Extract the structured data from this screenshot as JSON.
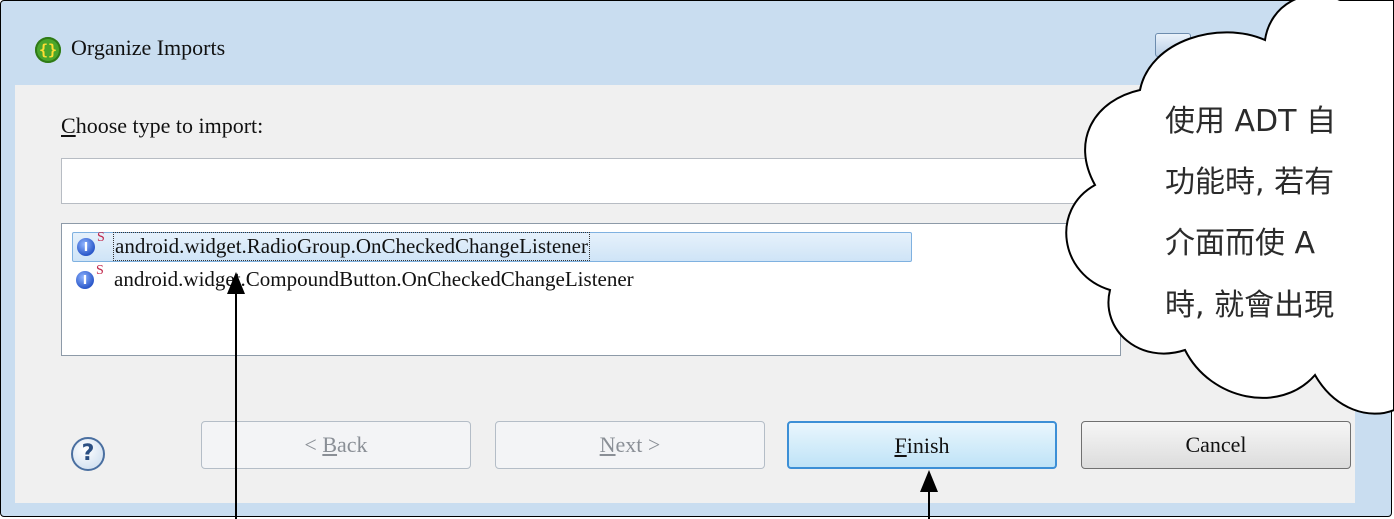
{
  "window": {
    "title": "Organize Imports",
    "app_icon": "braces-icon"
  },
  "dialog": {
    "label_accesskey": "C",
    "label_rest": "hoose type to import:",
    "filter_value": "",
    "items": [
      {
        "badge": "S",
        "text": "android.widget.RadioGroup.OnCheckedChangeListener",
        "selected": true
      },
      {
        "badge": "S",
        "text": "android.widget.CompoundButton.OnCheckedChangeListener",
        "selected": false
      }
    ],
    "buttons": {
      "back_prefix": "< ",
      "back_key": "B",
      "back_rest": "ack",
      "next_key": "N",
      "next_rest": "ext >",
      "finish_key": "F",
      "finish_rest": "inish",
      "cancel": "Cancel"
    },
    "help_glyph": "?"
  },
  "callout": {
    "lines": [
      "使用 ADT 自",
      "功能時, 若有",
      "介面而使 A",
      "時, 就會出現"
    ]
  }
}
